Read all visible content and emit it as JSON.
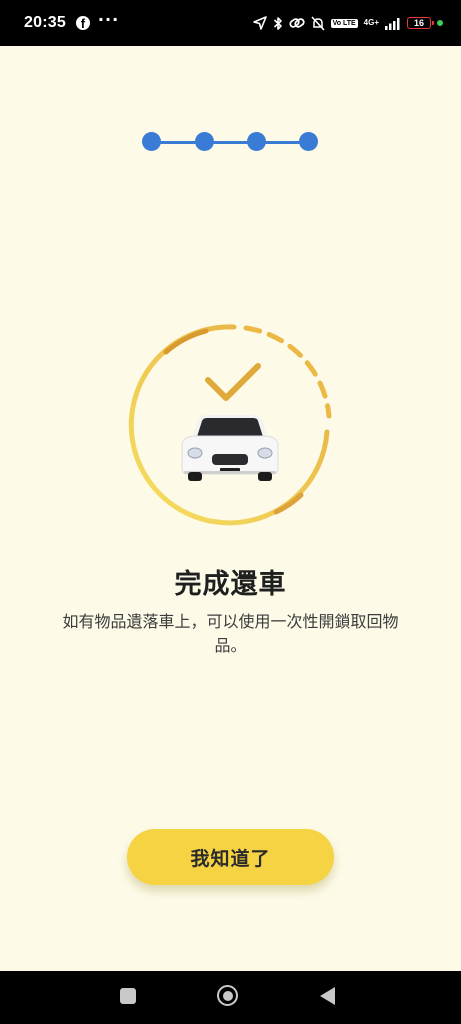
{
  "status_bar": {
    "time": "20:35",
    "notification_icons": [
      "facebook-icon",
      "more-icon"
    ],
    "indicator_icons": [
      "location-arrow-icon",
      "bluetooth-icon",
      "link-icon",
      "mute-icon",
      "volte-icon",
      "signal-icon",
      "battery-icon"
    ],
    "volte_label": "Vo LTE",
    "network_type": "4G+",
    "battery_level": "16",
    "battery_color": "#e53935",
    "active_dot_color": "#3ecf5a"
  },
  "stepper": {
    "total_steps": 4,
    "completed_steps": 4,
    "color": "#3a7bd5"
  },
  "hero": {
    "icons": [
      "progress-ring-icon",
      "checkmark-icon",
      "car-icon"
    ],
    "ring_colors": [
      "#f3d94d",
      "#e9b94a",
      "#d79b2e"
    ],
    "checkmark_color": "#e0a93a"
  },
  "content": {
    "title": "完成還車",
    "description": "如有物品遺落車上，可以使用一次性開鎖取回物品。"
  },
  "actions": {
    "confirm_label": "我知道了",
    "confirm_color": "#f5d343"
  },
  "nav_bar": {
    "icons": [
      "recent-apps-icon",
      "home-icon",
      "back-icon"
    ]
  },
  "colors": {
    "background": "#fdfbe8",
    "text_primary": "#1f1f1f",
    "text_secondary": "#3c3c3c"
  }
}
